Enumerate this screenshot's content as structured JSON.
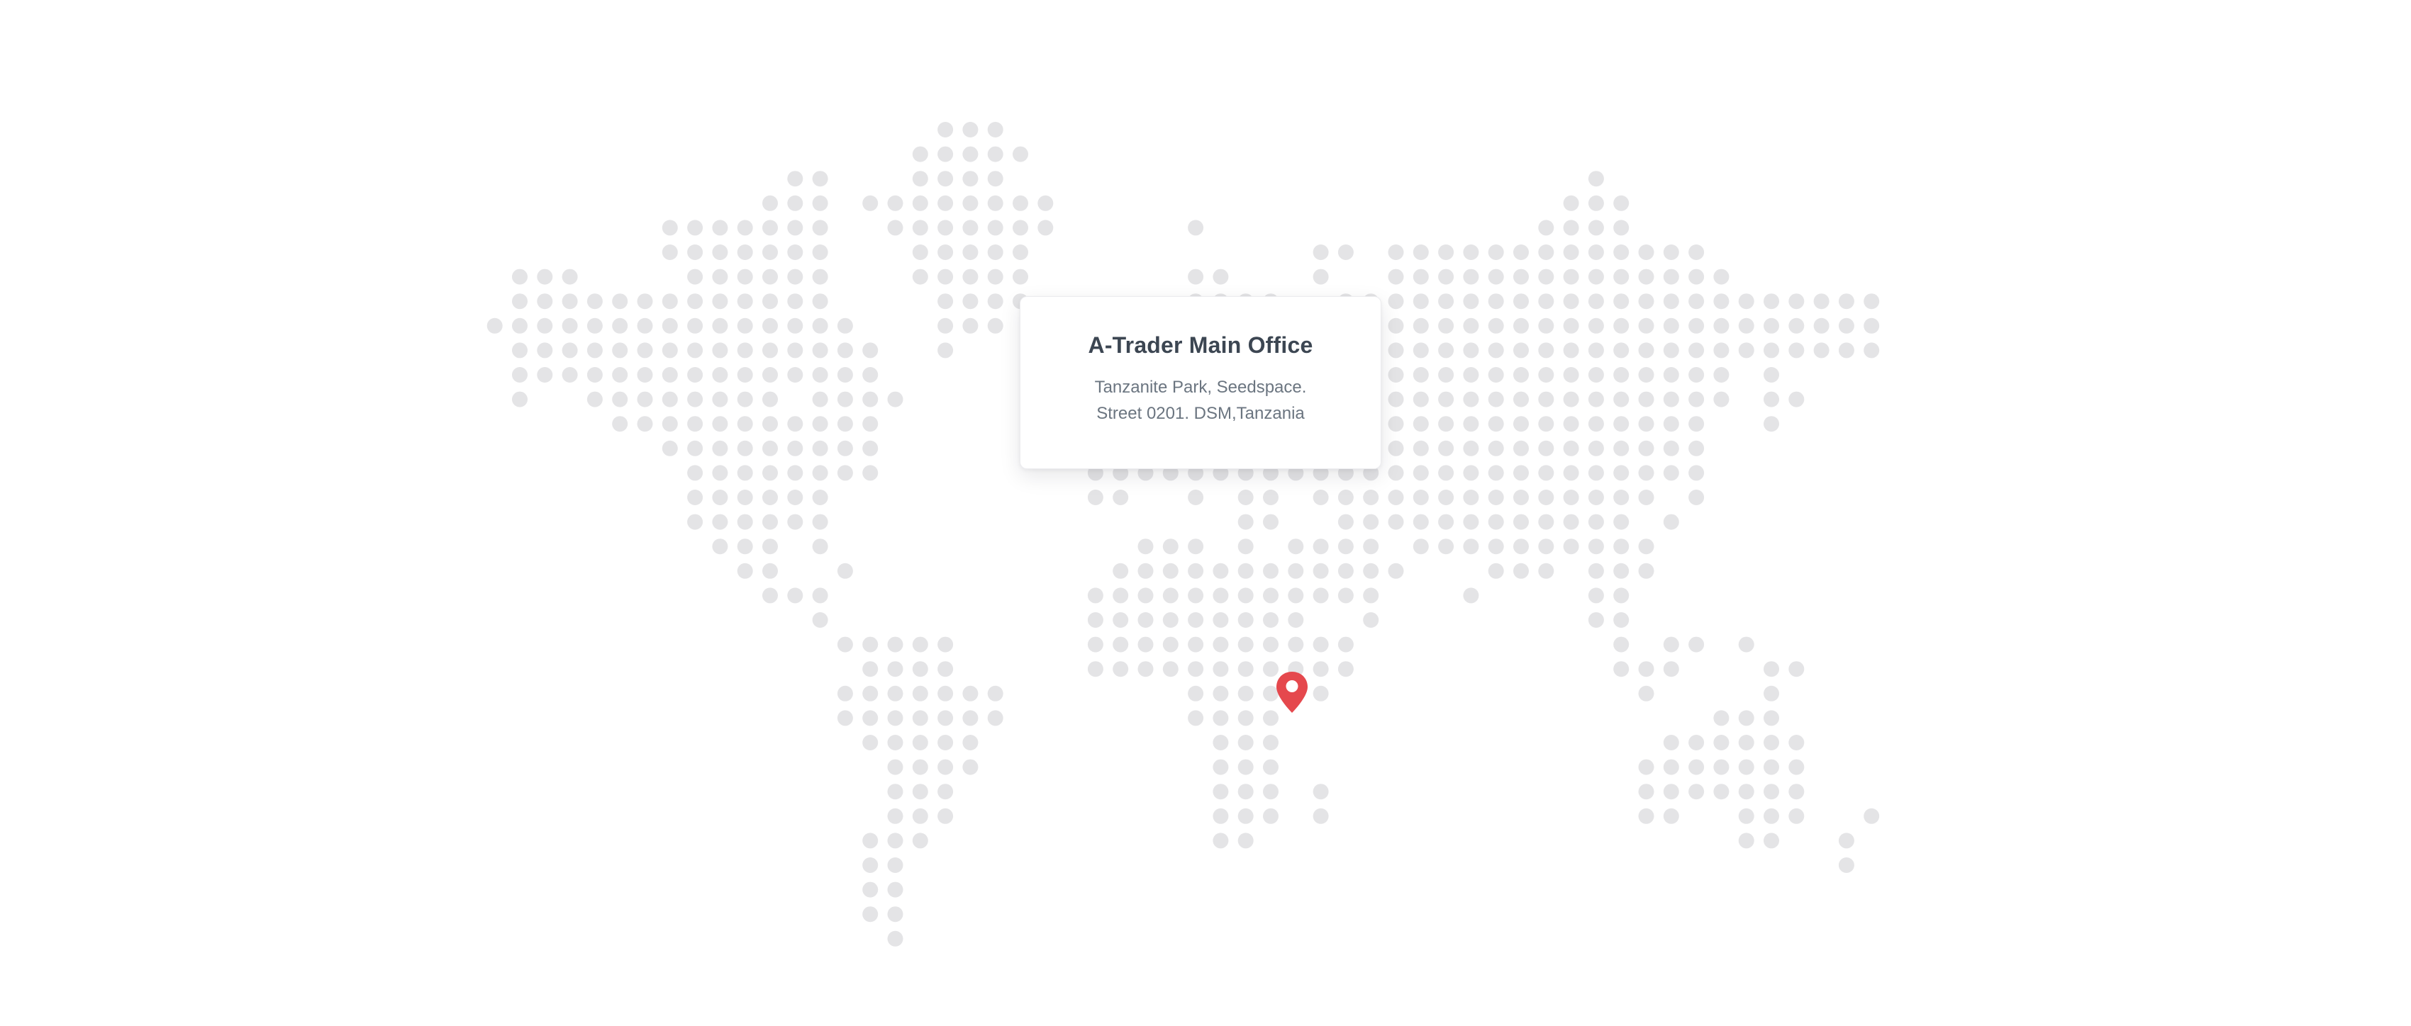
{
  "office": {
    "title": "A-Trader Main Office",
    "address_line1": "Tanzanite Park, Seedspace.",
    "address_line2": "Street 0201. DSM,Tanzania"
  },
  "map": {
    "dot_color": "#e4e4e6",
    "pin_color": "#e5484d",
    "pin_location": "Tanzania",
    "pin_icon": "map-marker-icon"
  }
}
